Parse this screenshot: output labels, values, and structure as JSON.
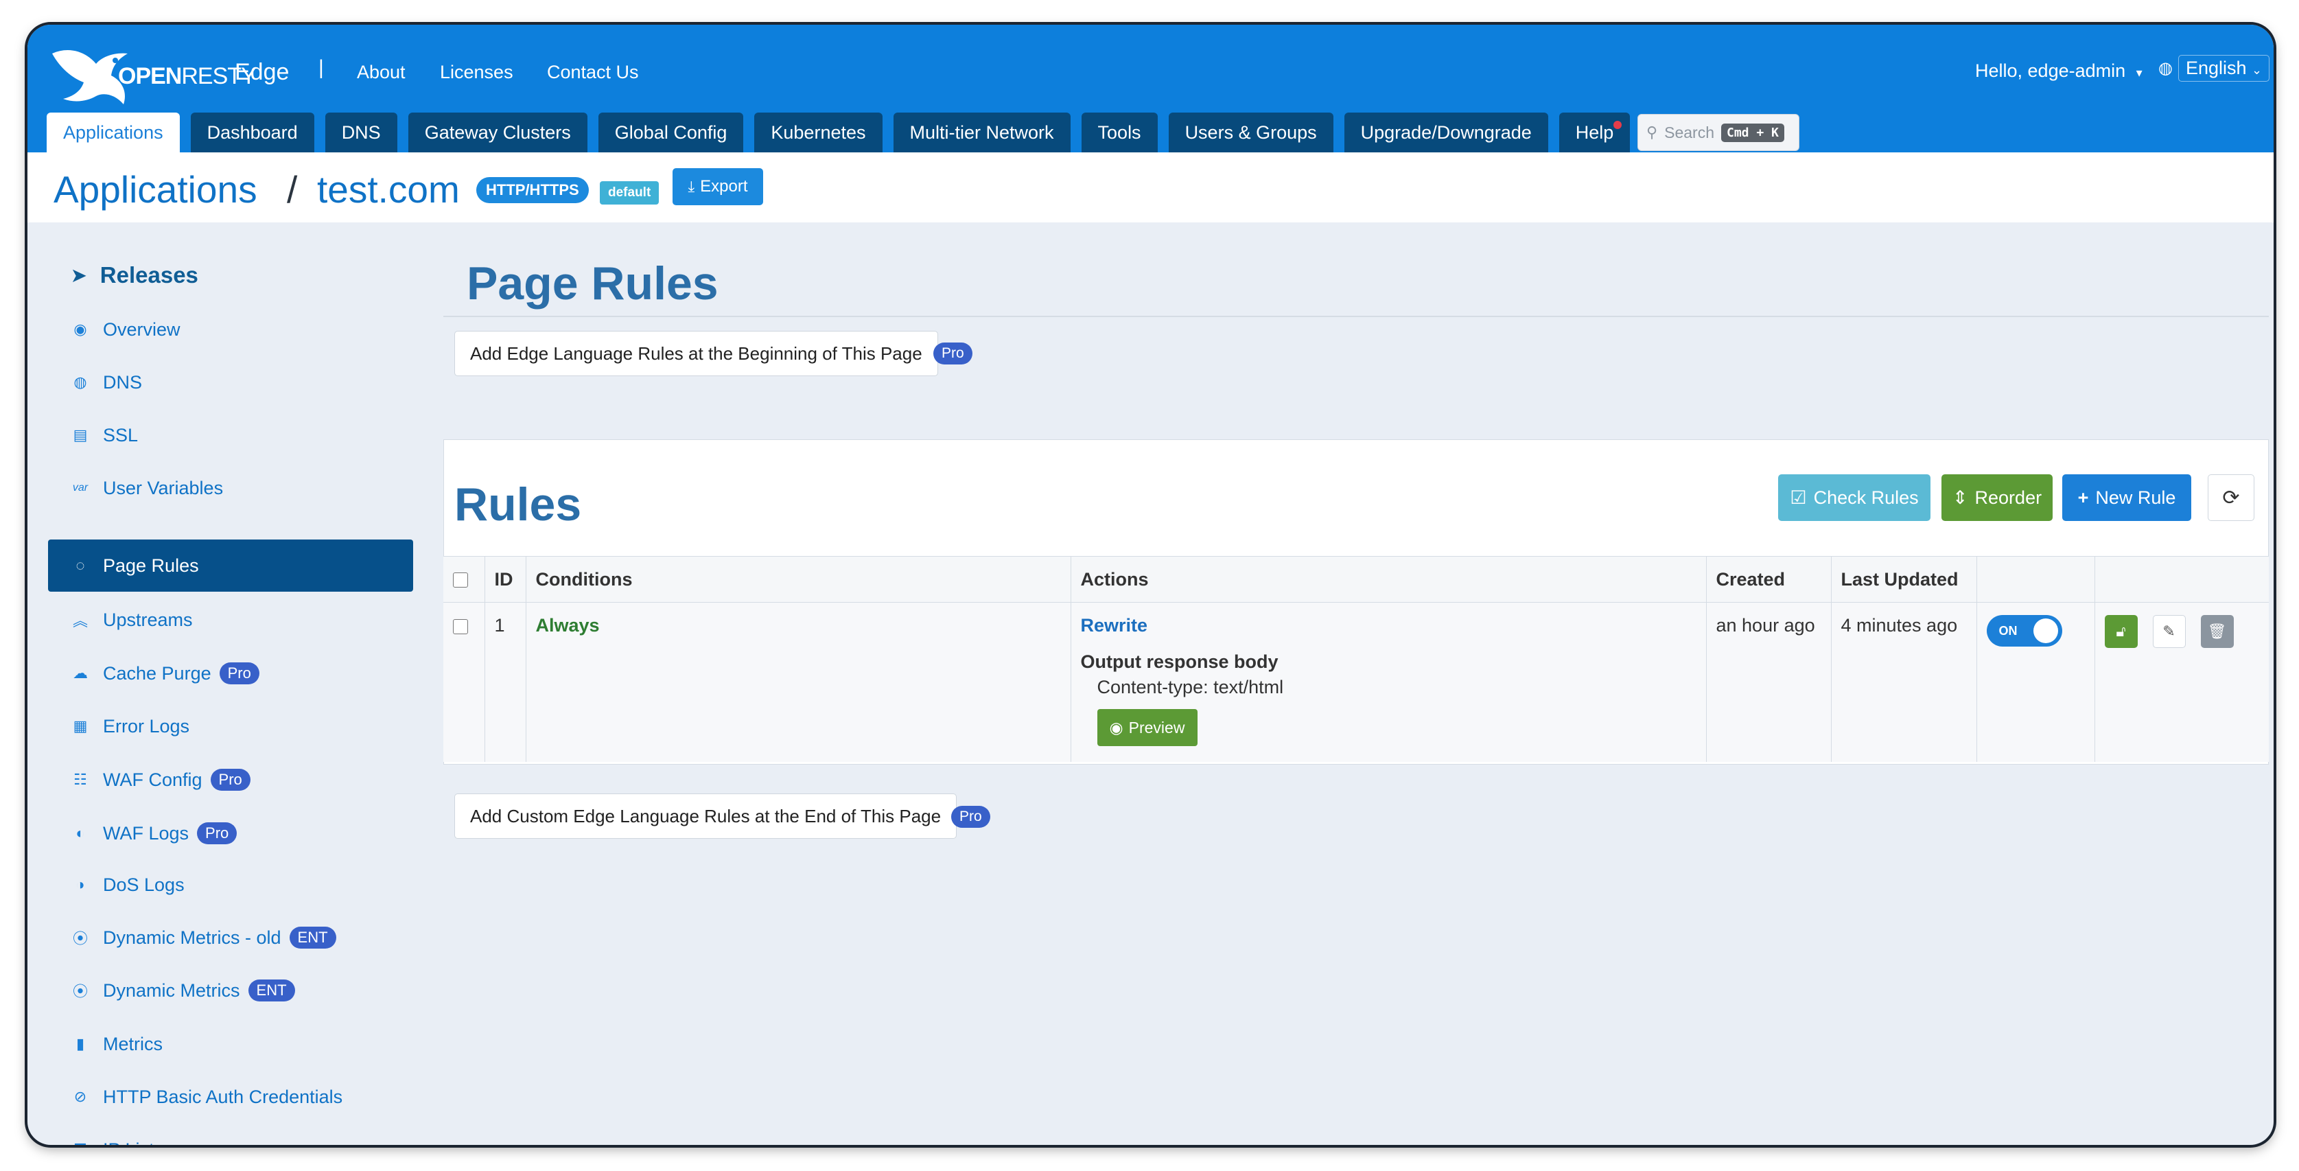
{
  "brand": {
    "logo_text_bold": "OPEN",
    "logo_text_thin": "RESTY",
    "product": "Edge",
    "separator": "|"
  },
  "top_nav": [
    "About",
    "Licenses",
    "Contact Us"
  ],
  "user_menu": "Hello, edge-admin",
  "language": "English",
  "tabs": [
    "Applications",
    "Dashboard",
    "DNS",
    "Gateway Clusters",
    "Global Config",
    "Kubernetes",
    "Multi-tier Network",
    "Tools",
    "Users & Groups",
    "Upgrade/Downgrade",
    "Help"
  ],
  "search": {
    "placeholder": "Search",
    "shortcut": "Cmd + K"
  },
  "breadcrumb": {
    "root": "Applications",
    "separator": "/",
    "app": "test.com",
    "protocol_badge": "HTTP/HTTPS",
    "env_badge": "default",
    "export_label": "Export"
  },
  "sidebar": {
    "heading": "Releases",
    "items": [
      {
        "label": "Overview",
        "icon": "dashboard-icon"
      },
      {
        "label": "DNS",
        "icon": "globe-icon"
      },
      {
        "label": "SSL",
        "icon": "certificate-icon"
      },
      {
        "label": "User Variables",
        "icon": "var-icon"
      },
      {
        "label": "Page Rules",
        "icon": "rules-icon",
        "active": true
      },
      {
        "label": "Upstreams",
        "icon": "upstream-icon"
      },
      {
        "label": "Cache Purge",
        "icon": "cache-icon",
        "badge": "Pro"
      },
      {
        "label": "Error Logs",
        "icon": "error-log-icon"
      },
      {
        "label": "WAF Config",
        "icon": "waf-config-icon",
        "badge": "Pro"
      },
      {
        "label": "WAF Logs",
        "icon": "waf-log-icon",
        "badge": "Pro"
      },
      {
        "label": "DoS Logs",
        "icon": "dos-log-icon"
      },
      {
        "label": "Dynamic Metrics - old",
        "icon": "metrics-pin-icon",
        "badge": "ENT"
      },
      {
        "label": "Dynamic Metrics",
        "icon": "metrics-pin-icon",
        "badge": "ENT"
      },
      {
        "label": "Metrics",
        "icon": "bar-chart-icon"
      },
      {
        "label": "HTTP Basic Auth Credentials",
        "icon": "auth-icon"
      },
      {
        "label": "IP Lists",
        "icon": "list-icon"
      }
    ]
  },
  "main": {
    "title": "Page Rules",
    "add_begin_label": "Add Edge Language Rules at the Beginning of This Page",
    "add_begin_badge": "Pro",
    "add_end_label": "Add Custom Edge Language Rules at the End of This Page",
    "add_end_badge": "Pro",
    "rules": {
      "title": "Rules",
      "buttons": {
        "check": "Check Rules",
        "reorder": "Reorder",
        "new": "New Rule"
      },
      "columns": [
        "ID",
        "Conditions",
        "Actions",
        "Created",
        "Last Updated"
      ],
      "rows": [
        {
          "id": "1",
          "condition": "Always",
          "action_title": "Rewrite",
          "action_detail": "Output response body",
          "action_sub": "Content-type: text/html",
          "preview_label": "Preview",
          "created": "an hour ago",
          "updated": "4 minutes ago",
          "toggle_label": "ON"
        }
      ]
    }
  },
  "colors": {
    "header": "#0d7fdc",
    "tab_dark": "#074a7c",
    "sidebar_active": "#06508a",
    "check_btn": "#5bbad5",
    "reorder_btn": "#5c9a35",
    "new_btn": "#1c80d8",
    "pill": "#3860c9"
  }
}
